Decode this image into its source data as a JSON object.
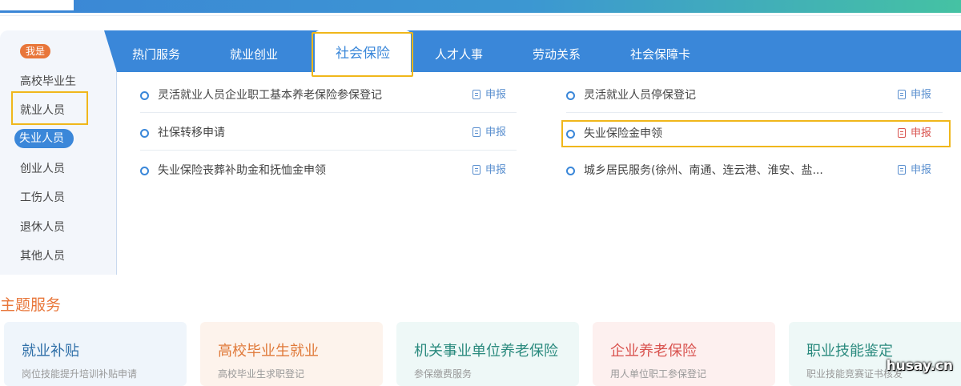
{
  "sidebar": {
    "badge": "我是",
    "items": [
      {
        "label": "高校毕业生"
      },
      {
        "label": "就业人员"
      },
      {
        "label": "失业人员"
      },
      {
        "label": "创业人员"
      },
      {
        "label": "工伤人员"
      },
      {
        "label": "退休人员"
      },
      {
        "label": "其他人员"
      }
    ],
    "active_index": 2
  },
  "tabs": [
    {
      "label": "热门服务"
    },
    {
      "label": "就业创业"
    },
    {
      "label": "社会保险"
    },
    {
      "label": "人才人事"
    },
    {
      "label": "劳动关系"
    },
    {
      "label": "社会保障卡"
    }
  ],
  "services": {
    "apply_label": "申报",
    "left": [
      {
        "name": "灵活就业人员企业职工基本养老保险参保登记"
      },
      {
        "name": "社保转移申请"
      },
      {
        "name": "失业保险丧葬补助金和抚恤金申领"
      }
    ],
    "right": [
      {
        "name": "灵活就业人员停保登记"
      },
      {
        "name": "失业保险金申领"
      },
      {
        "name": "城乡居民服务(徐州、南通、连云港、淮安、盐..."
      }
    ]
  },
  "theme": {
    "title": "主题服务",
    "cards": [
      {
        "title": "就业补贴",
        "subtitle": "岗位技能提升培训补贴申请"
      },
      {
        "title": "高校毕业生就业",
        "subtitle": "高校毕业生求职登记"
      },
      {
        "title": "机关事业单位养老保险",
        "subtitle": "参保缴费服务"
      },
      {
        "title": "企业养老保险",
        "subtitle": "用人单位职工参保登记"
      },
      {
        "title": "职业技能鉴定",
        "subtitle": "职业技能竞赛证书核发"
      }
    ]
  },
  "watermark": "husay.cn",
  "colors": {
    "tab_bar": "#3a87d9",
    "accent_orange": "#e8763a",
    "highlight": "#f0b71b",
    "apply_red": "#d9534f"
  }
}
